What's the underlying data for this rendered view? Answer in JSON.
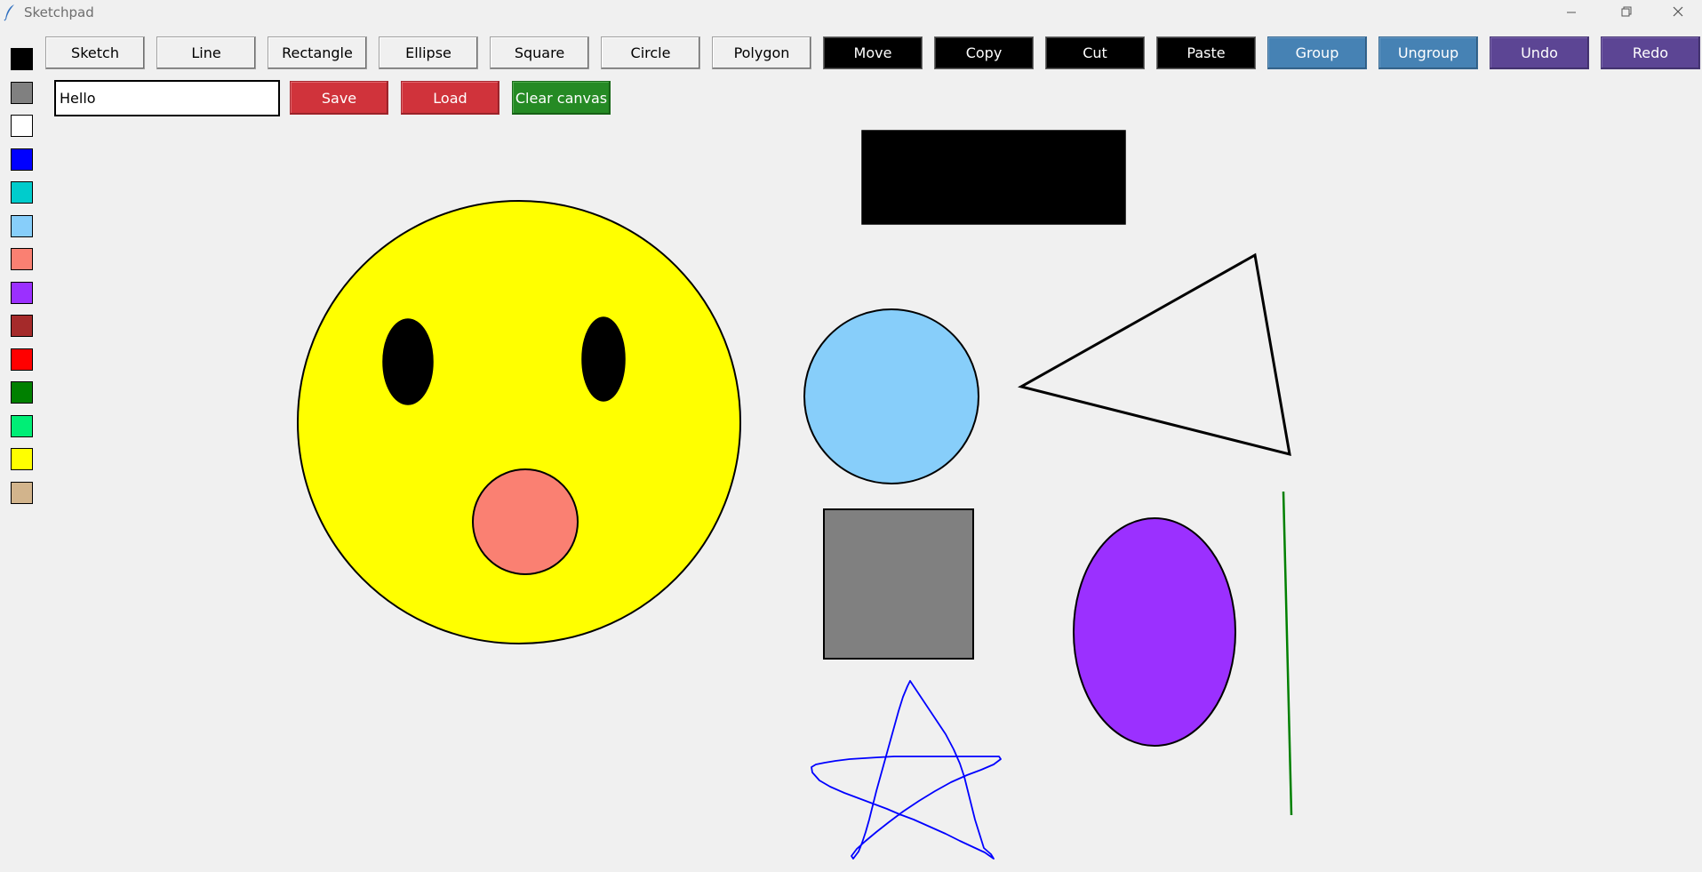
{
  "window": {
    "title": "Sketchpad",
    "app_icon": "feather-icon",
    "controls": [
      "minimize-icon",
      "restore-icon",
      "close-icon"
    ]
  },
  "palette": {
    "colors": [
      "#000000",
      "#808080",
      "#ffffff",
      "#0000ff",
      "#00cccc",
      "#87cefa",
      "#fa8072",
      "#9b30ff",
      "#a52a2a",
      "#ff0000",
      "#008000",
      "#00ee76",
      "#ffff00",
      "#d2b48c"
    ]
  },
  "toolbar": {
    "tools": [
      {
        "label": "Sketch",
        "style": "light"
      },
      {
        "label": "Line",
        "style": "light"
      },
      {
        "label": "Rectangle",
        "style": "light"
      },
      {
        "label": "Ellipse",
        "style": "light"
      },
      {
        "label": "Square",
        "style": "light"
      },
      {
        "label": "Circle",
        "style": "light"
      },
      {
        "label": "Polygon",
        "style": "light"
      },
      {
        "label": "Move",
        "style": "black"
      },
      {
        "label": "Copy",
        "style": "black"
      },
      {
        "label": "Cut",
        "style": "black"
      },
      {
        "label": "Paste",
        "style": "black"
      },
      {
        "label": "Group",
        "style": "blue"
      },
      {
        "label": "Ungroup",
        "style": "blue"
      },
      {
        "label": "Undo",
        "style": "purple"
      },
      {
        "label": "Redo",
        "style": "purple"
      }
    ]
  },
  "filebar": {
    "text_value": "Hello",
    "save_label": "Save",
    "load_label": "Load",
    "clear_label": "Clear canvas"
  },
  "colors": {
    "face": "#ffff00",
    "mouth": "#fa8072",
    "light_blue_circle": "#87cefa",
    "gray_square": "#808080",
    "purple_ellipse": "#9b30ff",
    "green_line": "#008000",
    "blue_star": "#0000ff"
  }
}
